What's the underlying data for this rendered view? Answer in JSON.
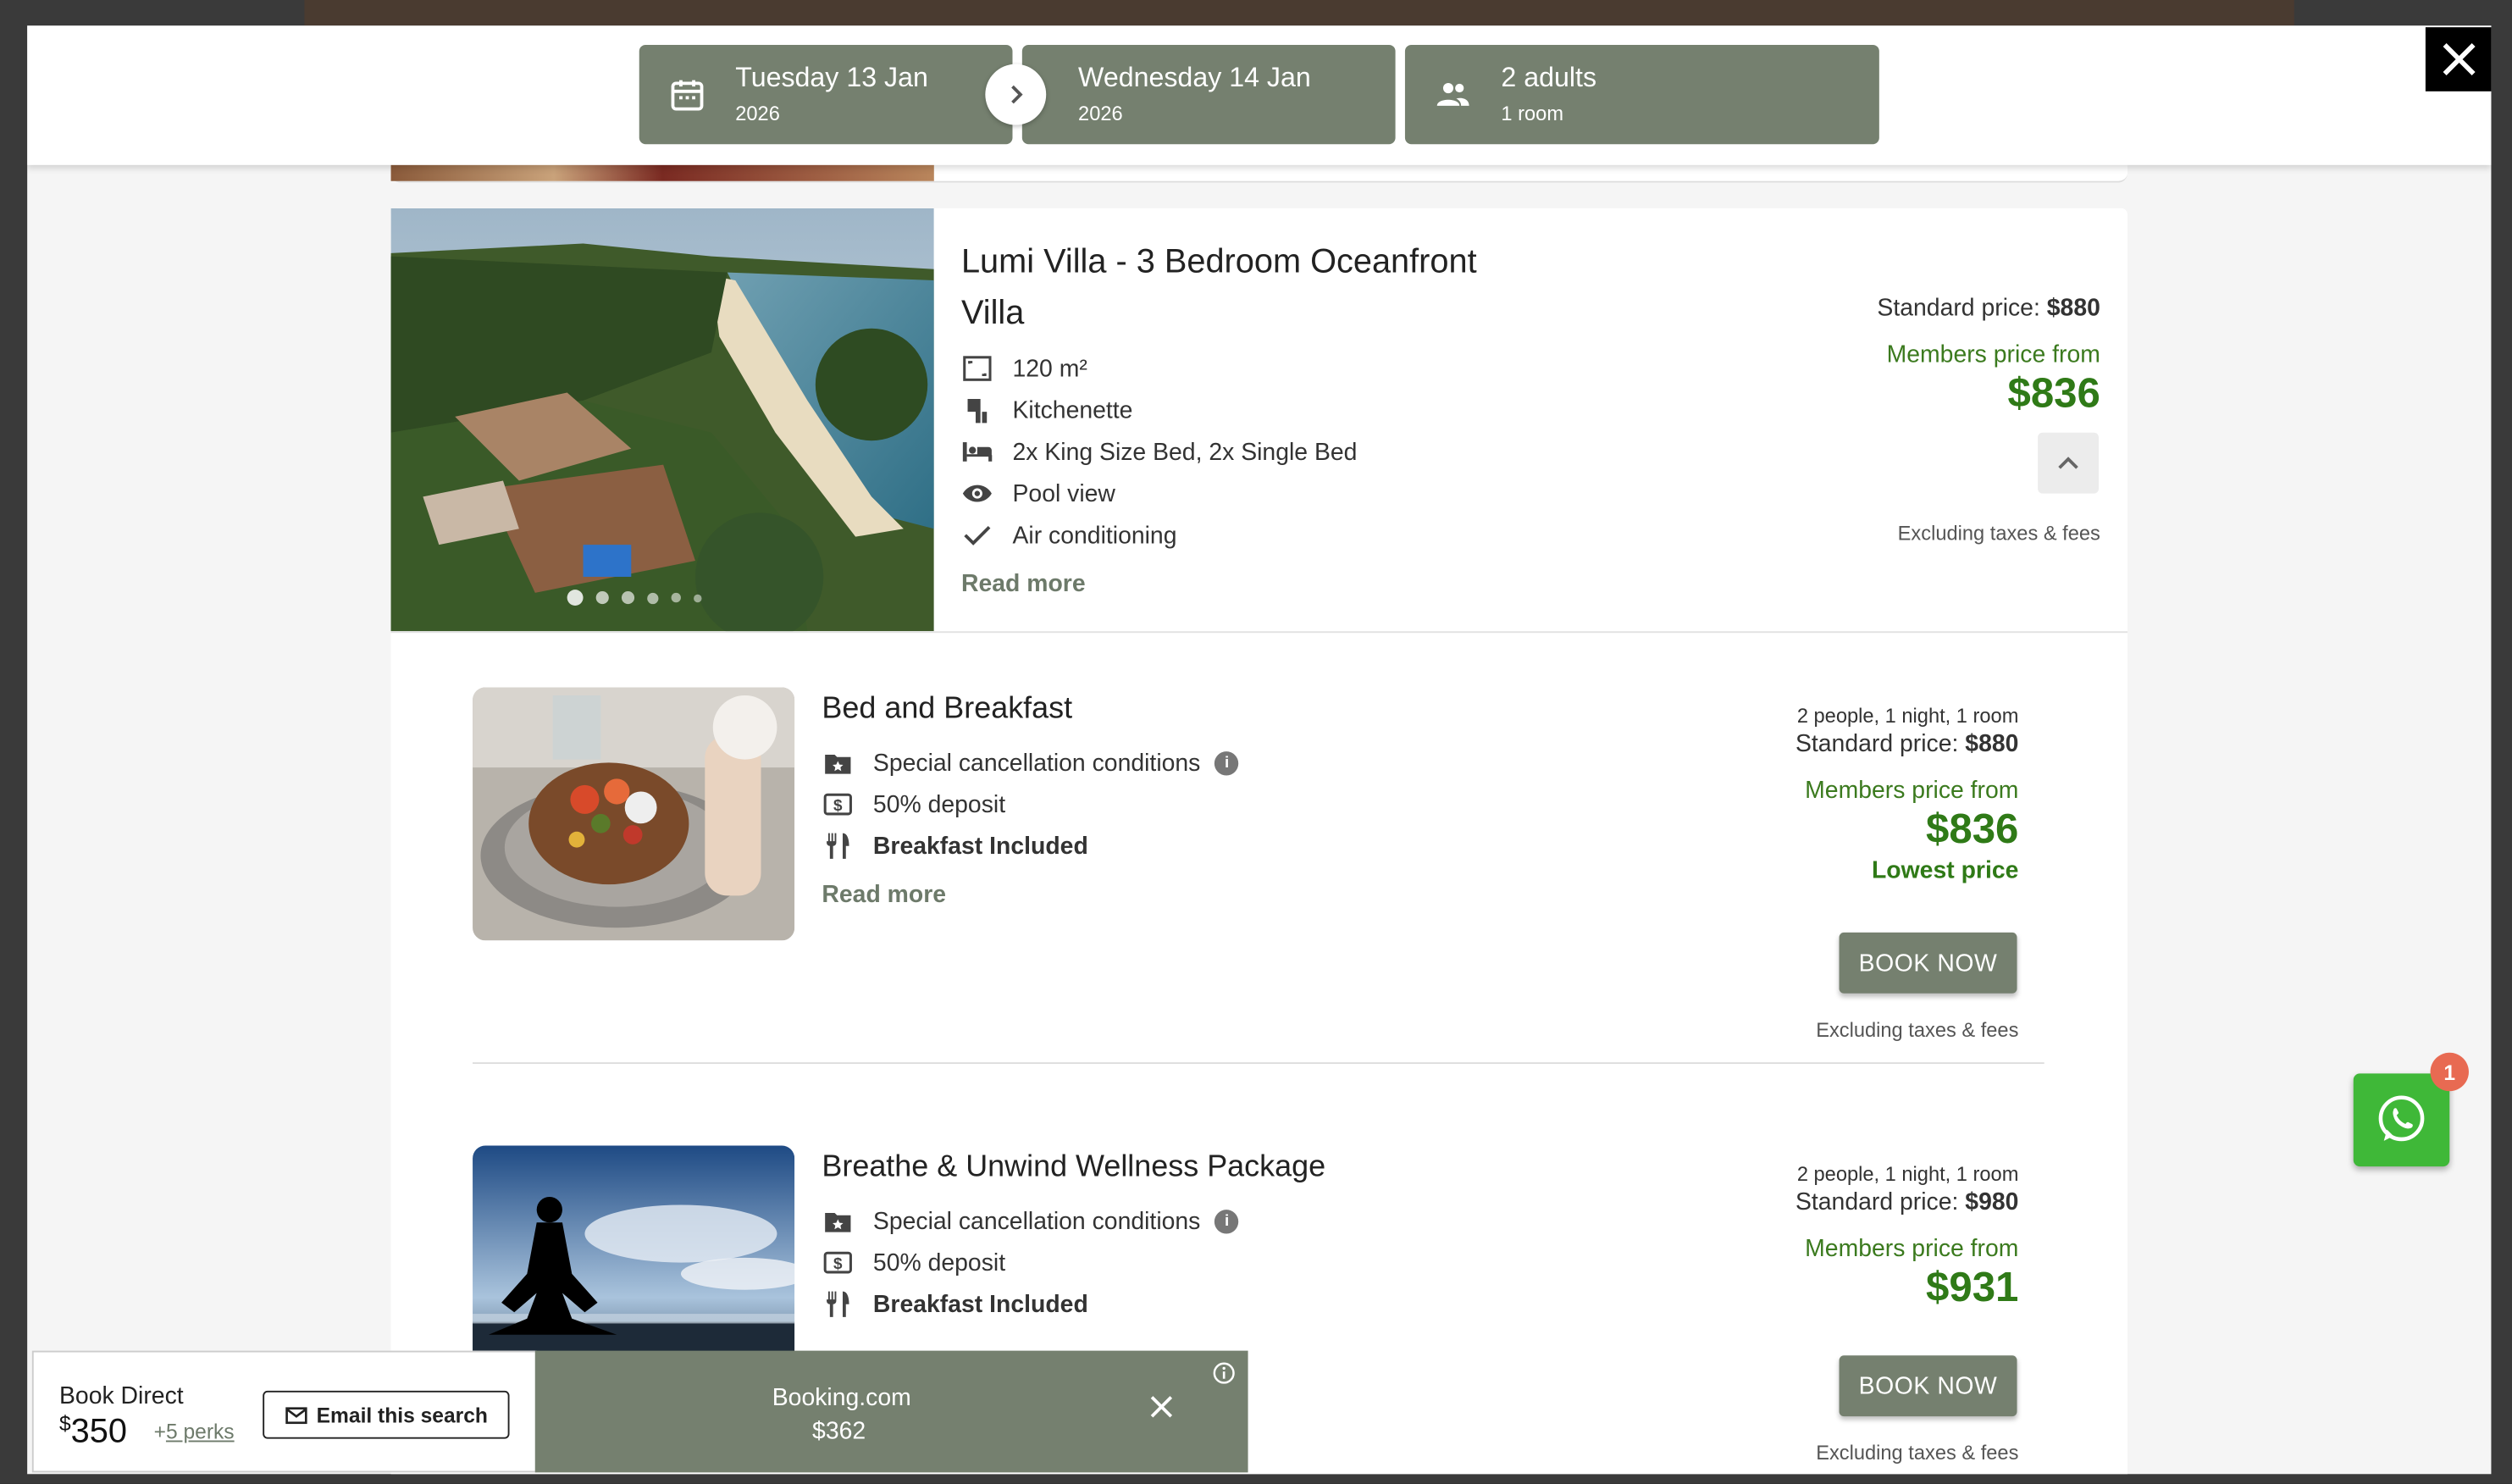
{
  "header": {
    "checkin": {
      "main": "Tuesday 13 Jan",
      "sub": "2026"
    },
    "checkout": {
      "main": "Wednesday 14 Jan",
      "sub": "2026"
    },
    "guests": {
      "main": "2 adults",
      "sub": "1 room"
    }
  },
  "villa": {
    "title_line1": "Lumi Villa - 3 Bedroom Oceanfront",
    "title_line2": "Villa",
    "features": [
      {
        "icon": "area-icon",
        "label": "120 m²"
      },
      {
        "icon": "kitchen-icon",
        "label": "Kitchenette"
      },
      {
        "icon": "bed-icon",
        "label": "2x King Size Bed, 2x Single Bed"
      },
      {
        "icon": "eye-icon",
        "label": "Pool view"
      },
      {
        "icon": "check-icon",
        "label": "Air conditioning"
      }
    ],
    "read_more": "Read more",
    "standard_label": "Standard price:",
    "standard_price": "$880",
    "members_label": "Members price from",
    "members_price": "$836",
    "excluding": "Excluding taxes & fees",
    "image_count": 6
  },
  "rates": [
    {
      "title": "Bed and Breakfast",
      "features": [
        "Special cancellation conditions",
        "50% deposit",
        "Breakfast Included"
      ],
      "read_more": "Read more",
      "people": "2 people, 1 night, 1 room",
      "standard_label": "Standard price:",
      "standard_price": "$880",
      "members_label": "Members price from",
      "members_price": "$836",
      "badge": "Lowest price",
      "book": "BOOK NOW",
      "excluding": "Excluding taxes & fees"
    },
    {
      "title": "Breathe & Unwind Wellness Package",
      "features": [
        "Special cancellation conditions",
        "50% deposit",
        "Breakfast Included"
      ],
      "people": "2 people, 1 night, 1 room",
      "standard_label": "Standard price:",
      "standard_price": "$980",
      "members_label": "Members price from",
      "members_price": "$931",
      "book": "BOOK NOW",
      "excluding": "Excluding taxes & fees"
    }
  ],
  "bottom_bar": {
    "book_direct_label": "Book Direct",
    "currency": "$",
    "book_direct_price": "350",
    "perks_prefix": "+",
    "perks": "5 perks",
    "email_button": "Email this search",
    "competitor_name": "Booking.com",
    "competitor_price": "$362"
  },
  "whatsapp": {
    "badge": "1"
  },
  "colors": {
    "accent": "#75806f",
    "member_green": "#2f7a17",
    "whatsapp": "#3fb838"
  }
}
